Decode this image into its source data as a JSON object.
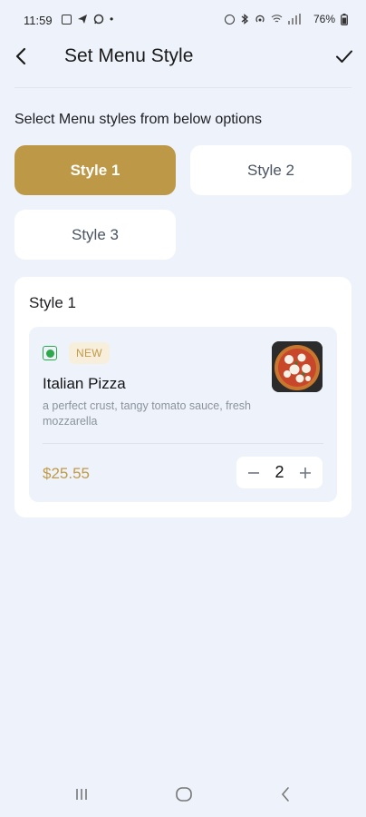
{
  "status_bar": {
    "time": "11:59",
    "dot": "•",
    "battery": "76%",
    "left_icons": [
      "gallery-icon",
      "telegram-icon",
      "whatsapp-icon"
    ],
    "right_icons": [
      "alarm-icon",
      "bluetooth-icon",
      "hotspot-icon",
      "wifi-icon",
      "signal-icon",
      "battery-icon"
    ]
  },
  "app_bar": {
    "title": "Set Menu Style"
  },
  "instruction": "Select Menu styles from below options",
  "styles": [
    {
      "label": "Style 1",
      "selected": true
    },
    {
      "label": "Style 2",
      "selected": false
    },
    {
      "label": "Style 3",
      "selected": false
    }
  ],
  "preview": {
    "title": "Style 1",
    "item": {
      "badge": "NEW",
      "name": "Italian Pizza",
      "description": "a perfect crust, tangy tomato sauce, fresh mozzarella",
      "price": "$25.55",
      "quantity": "2",
      "veg": true,
      "image": "pizza-image"
    }
  },
  "colors": {
    "accent": "#bd9846",
    "price": "#c19a47",
    "veg_green": "#2da84a",
    "background": "#eef3fb"
  }
}
